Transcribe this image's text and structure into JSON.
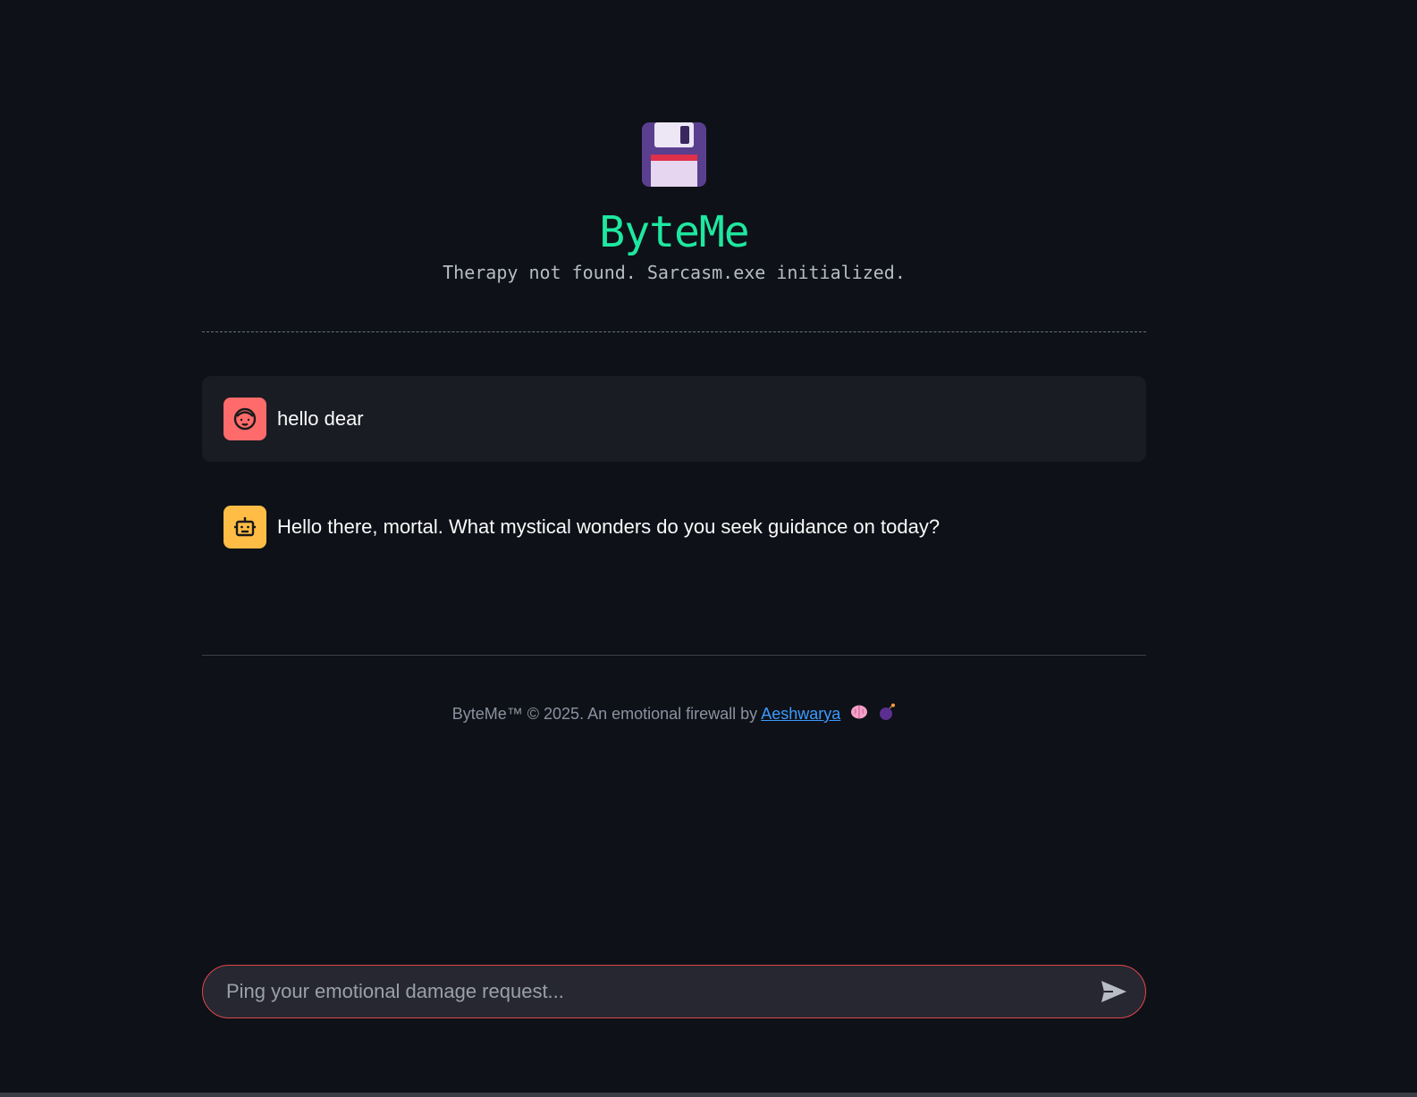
{
  "app": {
    "logo_icon": "floppy-disk-icon",
    "title": "ByteMe",
    "subtitle": "Therapy not found. Sarcasm.exe initialized."
  },
  "messages": [
    {
      "role": "user",
      "avatar_icon": "user-face-icon",
      "text": "hello dear"
    },
    {
      "role": "assistant",
      "avatar_icon": "robot-icon",
      "text": "Hello there, mortal. What mystical wonders do you seek guidance on today?"
    }
  ],
  "footer": {
    "prefix": "ByteMe™ © 2025. An emotional firewall by",
    "author_link": "Aeshwarya",
    "emojis": [
      "brain-icon",
      "bomb-icon"
    ]
  },
  "chat_input": {
    "placeholder": "Ping your emotional damage request...",
    "value": "",
    "send_icon": "send-icon"
  },
  "colors": {
    "background": "#0e1117",
    "title": "#1ee8a0",
    "user_avatar": "#ff6b6b",
    "bot_avatar": "#ffbd45",
    "link": "#3b9bff",
    "input_border": "#e2454d"
  }
}
